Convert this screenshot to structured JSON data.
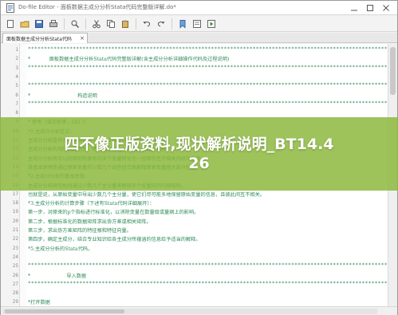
{
  "window": {
    "title": "Do-file Editor - 面板数据主成分分析Stata代码完整版详解.do*",
    "icon": "stata-doc-icon"
  },
  "toolbar": {
    "buttons": [
      "new-file-icon",
      "open-folder-icon",
      "save-icon",
      "print-icon",
      "find-icon",
      "cut-icon",
      "copy-icon",
      "paste-icon",
      "undo-icon",
      "redo-icon",
      "bookmark-icon",
      "run-icon",
      "do-icon"
    ]
  },
  "tab": {
    "label": "面板数据主成分分析Stata代码"
  },
  "editor": {
    "lines": [
      {
        "n": "1",
        "fold": "",
        "text": "*****************************************************************************************************************"
      },
      {
        "n": "2",
        "fold": "",
        "text": "*            面板数据主成分分析Stata代码完整版详解(含主成分分析详细操作代码及过程说明)"
      },
      {
        "n": "3",
        "fold": "",
        "text": "*****************************************************************************************************************"
      },
      {
        "n": "4",
        "fold": "",
        "text": ""
      },
      {
        "n": "5",
        "fold": "",
        "text": "*****************************************************************************************************************"
      },
      {
        "n": "6",
        "fold": "",
        "text": "*                              构造说明"
      },
      {
        "n": "7",
        "fold": "",
        "text": "*****************************************************************************************************************"
      },
      {
        "n": "8",
        "fold": "",
        "text": ""
      },
      {
        "n": "9",
        "fold": "",
        "text": "* 参考（张文彤等，2017)"
      },
      {
        "n": "10",
        "fold": "",
        "text": "*1.主成分分析定义："
      },
      {
        "n": "11",
        "fold": "",
        "text": "主成分分析是将多个指标化为少数综合指标的一种统计分析方法。"
      },
      {
        "n": "12",
        "fold": "",
        "text": "主成分分析利用降维的思想，把多指标转化为少数几个综合指标。"
      },
      {
        "n": "13",
        "fold": "",
        "text": "主成分分析用可以的原则将原有的多个变量转化为一组新的互不相关的综合变量。"
      },
      {
        "n": "14",
        "fold": "",
        "text": "其基本原理是通过原来变量的少数几个线性组合来解释原来变量绝大部分信息。"
      },
      {
        "n": "15",
        "fold": "",
        "text": "*2.主成分分析的基本思想："
      },
      {
        "n": "16",
        "fold": "",
        "text": "主成分分析研究如何通过少数几个主分量来解释多个变量间的内部结构。"
      },
      {
        "n": "17",
        "fold": "",
        "text": "也就是说，从原始变量中导出少数几个主分量，使它们尽可能多地保留原始变量的信息，且彼此间互不相关。"
      },
      {
        "n": "18",
        "fold": "",
        "text": "*3.主成分分析的计算步骤（下述有Stata代码详细展开）："
      },
      {
        "n": "19",
        "fold": "",
        "text": "第一步，对原来的p个指标进行标准化，以消除变量在数量级或量纲上的影响。"
      },
      {
        "n": "20",
        "fold": "",
        "text": "第二步，根据标准化的数据矩阵求出协方差或相关矩阵。"
      },
      {
        "n": "21",
        "fold": "",
        "text": "第三步，求出协方差矩阵的特征根和特征向量。"
      },
      {
        "n": "22",
        "fold": "",
        "text": "第四步，确定主成分，结合专业知识给各主成分所蕴涵的信息给予适当的解释。"
      },
      {
        "n": "23",
        "fold": "",
        "text": "*5.主成分分析的Stata代码。"
      },
      {
        "n": "24",
        "fold": "",
        "text": ""
      },
      {
        "n": "25",
        "fold": "",
        "text": "*****************************************************************************************************************"
      },
      {
        "n": "26",
        "fold": "",
        "text": "*                       导入数据"
      },
      {
        "n": "27",
        "fold": "",
        "text": "*****************************************************************************************************************"
      },
      {
        "n": "28",
        "fold": "",
        "text": ""
      },
      {
        "n": "29",
        "fold": "",
        "text": "*打开数据"
      }
    ]
  },
  "overlay": {
    "text": "四不像正版资料,现状解析说明_BT14.426"
  },
  "colors": {
    "comment": "#2e8b57",
    "overlay": "#8ab83a",
    "tab_active": "#ffffff"
  }
}
